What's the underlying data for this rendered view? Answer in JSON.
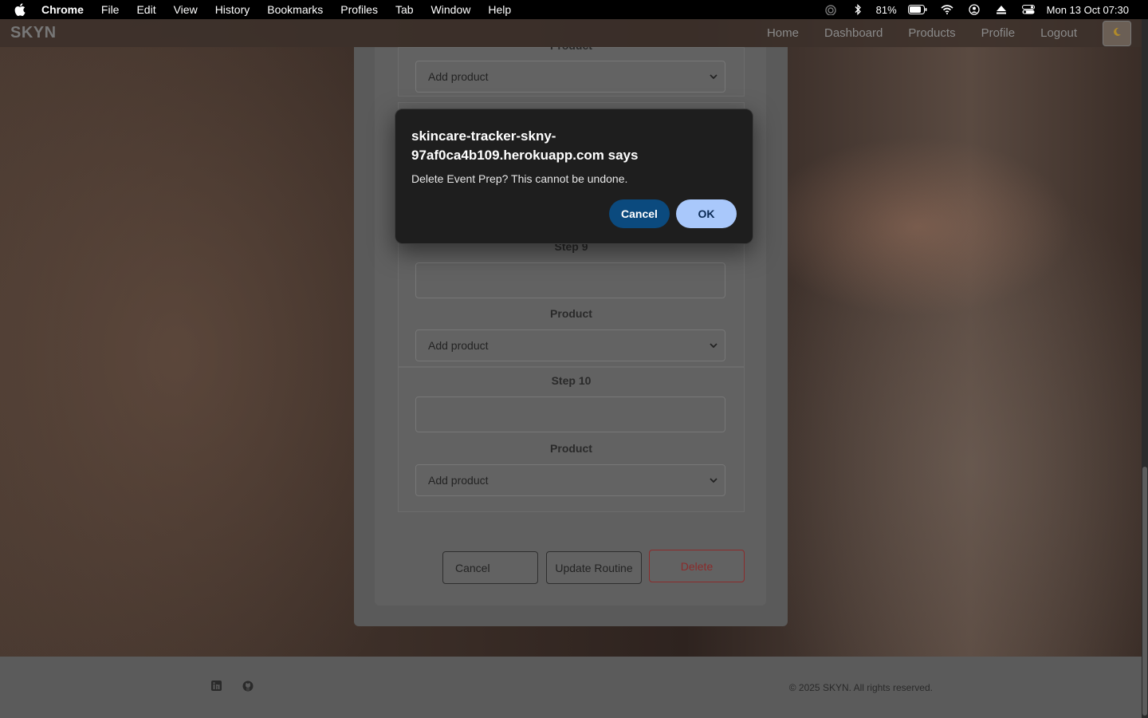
{
  "menubar": {
    "app": "Chrome",
    "items": [
      "File",
      "Edit",
      "View",
      "History",
      "Bookmarks",
      "Profiles",
      "Tab",
      "Window",
      "Help"
    ],
    "battery": "81%",
    "datetime": "Mon 13 Oct  07:30"
  },
  "navbar": {
    "brand": "SKYN",
    "links": [
      "Home",
      "Dashboard",
      "Products",
      "Profile",
      "Logout"
    ],
    "theme_icon": "moon-icon"
  },
  "form": {
    "top_product_label": "Product",
    "step9_label": "Step 9",
    "step10_label": "Step 10",
    "product_label": "Product",
    "select_placeholder": "Add product",
    "buttons": {
      "cancel": "Cancel",
      "update": "Update Routine",
      "delete": "Delete"
    }
  },
  "dialog": {
    "title": "skincare-tracker-skny-97af0ca4b109.herokuapp.com says",
    "message": "Delete Event Prep? This cannot be undone.",
    "cancel": "Cancel",
    "ok": "OK"
  },
  "footer": {
    "copyright": "© 2025 SKYN. All rights reserved.",
    "icons": [
      "linkedin-icon",
      "github-icon"
    ]
  }
}
